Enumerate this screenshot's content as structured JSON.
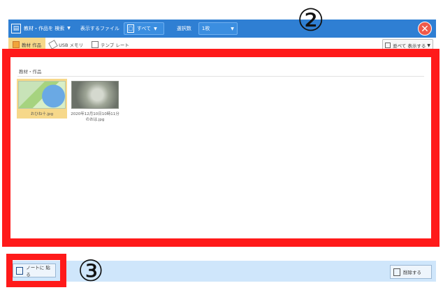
{
  "toolbar": {
    "search_label": "教材・作品を 検索",
    "files_label": "表示するファイル",
    "files_value": "すべて",
    "selected_label": "選択数",
    "selected_value": "1枚"
  },
  "tabs": [
    {
      "label": "教材 作品",
      "active": true
    },
    {
      "label": "USB メモリ",
      "active": false
    },
    {
      "label": "テンプ レート",
      "active": false
    }
  ],
  "sort_label": "並べて 表示する",
  "folder_label": "教材・作品",
  "items": [
    {
      "label": "おひね十.jpg",
      "kind": "map",
      "selected": true
    },
    {
      "label": "2020年12月10日10時11分のおは.jpg",
      "kind": "photo",
      "selected": false
    }
  ],
  "bottom": {
    "paste_label": "ノートに 貼る",
    "delete_label": "削除する"
  },
  "annotations": {
    "two": "②",
    "three": "③"
  },
  "colors": {
    "toolbar": "#2f7fd3",
    "highlight": "#ff1a1a",
    "selected": "#f6d88a",
    "bottom_bar": "#cfe6fb"
  }
}
